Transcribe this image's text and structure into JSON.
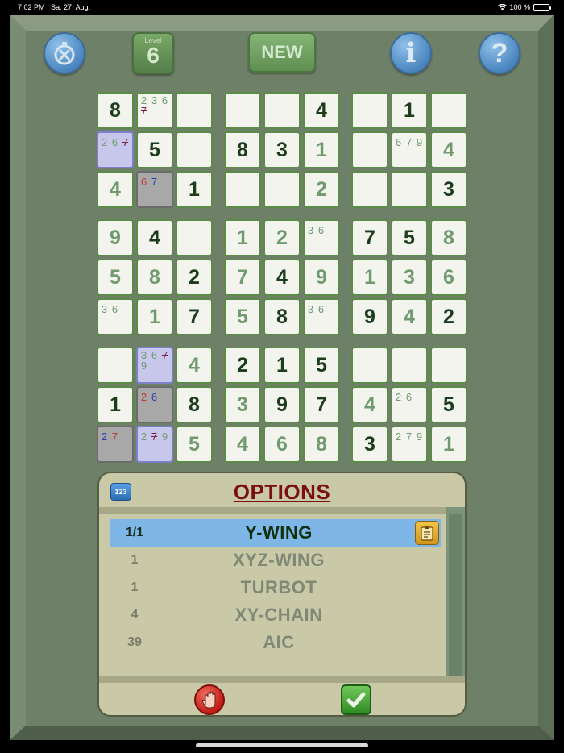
{
  "status": {
    "time": "7:02 PM",
    "date": "Sa. 27. Aug.",
    "battery": "100 %"
  },
  "toolbar": {
    "level_label": "Level",
    "level_value": "6",
    "new_label": "NEW",
    "info_label": "i",
    "help_label": "?"
  },
  "grid": [
    [
      "8",
      [
        "2",
        "3",
        "6",
        "7*"
      ],
      "",
      "",
      "",
      "4",
      "",
      "1",
      ""
    ],
    [
      [
        "2",
        "6",
        "7*"
      ],
      "5",
      "",
      "8",
      "3",
      "~1",
      "",
      [
        "6",
        "7",
        "9"
      ],
      "~4"
    ],
    [
      "~4",
      [
        "6r",
        "7b"
      ],
      "1",
      "",
      "",
      "~2",
      "",
      "",
      "3"
    ],
    [
      "~9",
      "4",
      "",
      "~1",
      "~2",
      [
        "3",
        "6"
      ],
      "7",
      "5",
      "~8"
    ],
    [
      "~5",
      "~8",
      "2",
      "~7",
      "4",
      "~9",
      "~1",
      "~3",
      "~6"
    ],
    [
      [
        "3",
        "6"
      ],
      "~1",
      "7",
      "~5",
      "8",
      [
        "3",
        "6"
      ],
      "9",
      "~4",
      "2"
    ],
    [
      "",
      [
        "3",
        "6",
        "7*",
        "9"
      ],
      "~4",
      "2",
      "1",
      "5",
      "",
      "",
      ""
    ],
    [
      "1",
      [
        "2r",
        "6b"
      ],
      "8",
      "~3",
      "9",
      "7",
      "~4",
      [
        "2",
        "6"
      ],
      "5"
    ],
    [
      [
        "2b",
        "7r"
      ],
      [
        "2",
        "7*",
        "9"
      ],
      "~5",
      "~4",
      "~6",
      "~8",
      "3",
      [
        "2",
        "7",
        "9"
      ],
      "~1"
    ]
  ],
  "highlights": {
    "1,0": "blue",
    "2,1": "gray",
    "6,1": "blue",
    "7,1": "gray",
    "8,0": "gray",
    "8,1": "blue"
  },
  "options": {
    "title": "OPTIONS",
    "badge": "123",
    "items": [
      {
        "count": "1/1",
        "name": "Y-WING",
        "selected": true
      },
      {
        "count": "1",
        "name": "XYZ-WING",
        "selected": false
      },
      {
        "count": "1",
        "name": "TURBOT",
        "selected": false
      },
      {
        "count": "4",
        "name": "XY-CHAIN",
        "selected": false
      },
      {
        "count": "39",
        "name": "AIC",
        "selected": false
      }
    ]
  },
  "icons": {
    "timer": "stopwatch-icon",
    "info": "info-icon",
    "help": "help-icon",
    "copy": "clipboard-icon",
    "stop": "hand-stop-icon",
    "confirm": "checkmark-icon"
  },
  "colors": {
    "given": "#1c3d1c",
    "solved": "#6f9b6f",
    "title": "#7a1010",
    "selected_row": "#7fb6e8"
  }
}
